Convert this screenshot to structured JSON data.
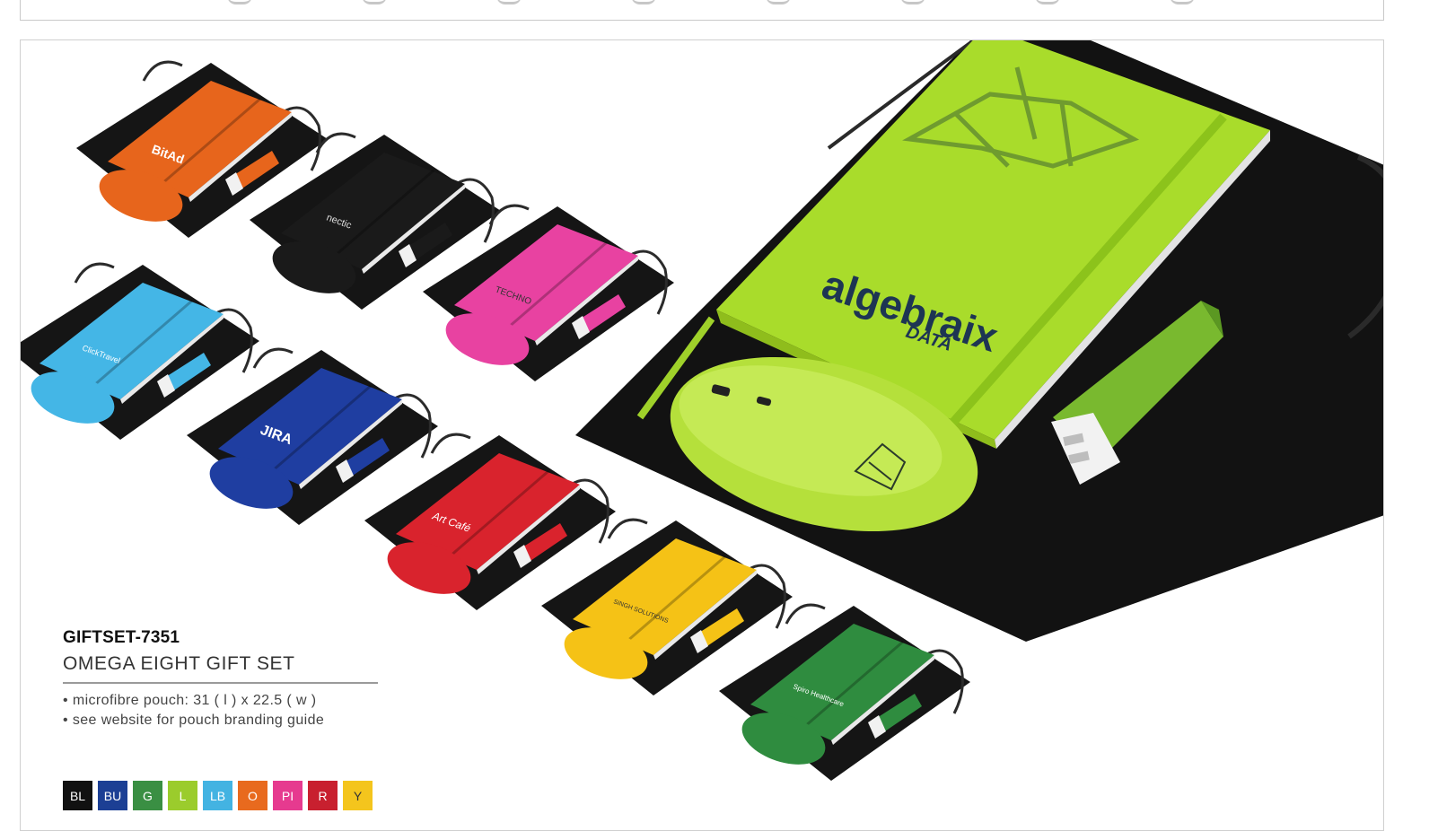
{
  "product": {
    "code": "GIFTSET-7351",
    "name": "OMEGA EIGHT GIFT SET",
    "features": [
      "• microfibre pouch: 31 ( l ) x 22.5 ( w )",
      "• see website for pouch branding guide"
    ]
  },
  "colour_swatches": [
    {
      "code": "BL",
      "color": "#111111"
    },
    {
      "code": "BU",
      "color": "#1c3f94"
    },
    {
      "code": "G",
      "color": "#3a8f43"
    },
    {
      "code": "L",
      "color": "#9bcc2c"
    },
    {
      "code": "LB",
      "color": "#43b3e2"
    },
    {
      "code": "O",
      "color": "#e86a1e"
    },
    {
      "code": "PI",
      "color": "#e63a8f"
    },
    {
      "code": "R",
      "color": "#c8202f"
    },
    {
      "code": "Y",
      "color": "#f4c51d"
    }
  ],
  "photo_brands": {
    "orange": "BitAd",
    "black": "nectic",
    "pink": "TECHNO",
    "lightblue": "ClickTravel",
    "blue": "JIRA",
    "red": "Art Café",
    "yellow": "SINGH SOLUTIONS",
    "green": "Spiro Healthcare",
    "lime": "algebraix",
    "lime_sub": "DATA"
  }
}
